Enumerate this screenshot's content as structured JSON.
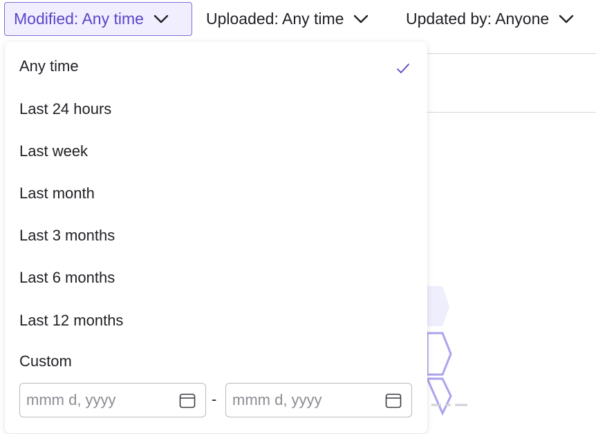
{
  "filters": {
    "modified": {
      "label": "Modified: Any time",
      "icon": "chevron-down-icon"
    },
    "uploaded": {
      "label": "Uploaded: Any time",
      "icon": "chevron-down-icon"
    },
    "updated_by": {
      "label": "Updated by: Anyone",
      "icon": "chevron-down-icon"
    }
  },
  "dropdown": {
    "selected": "Any time",
    "options": [
      {
        "label": "Any time",
        "selected": true
      },
      {
        "label": "Last 24 hours",
        "selected": false
      },
      {
        "label": "Last week",
        "selected": false
      },
      {
        "label": "Last month",
        "selected": false
      },
      {
        "label": "Last 3 months",
        "selected": false
      },
      {
        "label": "Last 6 months",
        "selected": false
      },
      {
        "label": "Last 12 months",
        "selected": false
      }
    ],
    "custom": {
      "label": "Custom",
      "start_placeholder": "mmm d, yyyy",
      "separator": "-",
      "end_placeholder": "mmm d, yyyy",
      "icon": "calendar-icon"
    }
  },
  "colors": {
    "accent": "#5b45c8",
    "active_bg": "#f1efff",
    "active_border": "#7c6fd4",
    "check": "#5b45c8",
    "illustration": "#a9a3ee"
  }
}
